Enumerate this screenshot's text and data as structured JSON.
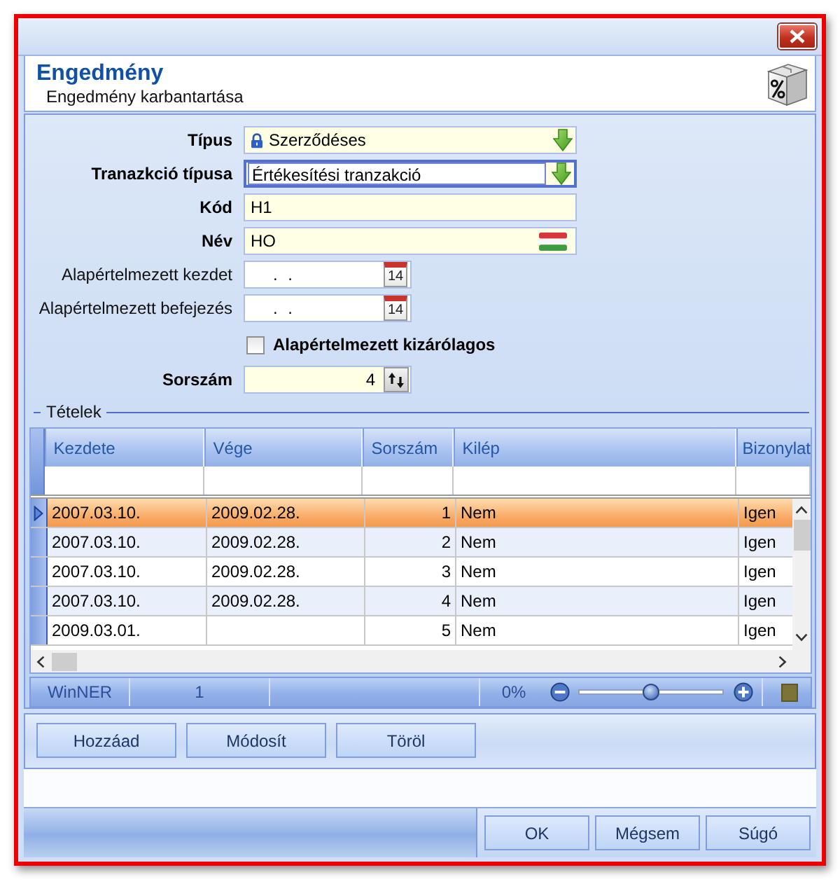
{
  "header": {
    "title": "Engedmény",
    "subtitle": "Engedmény karbantartása"
  },
  "form": {
    "fields": [
      {
        "kind": "dropdown",
        "label": "Típus",
        "value": "Szerződéses",
        "required": true,
        "locked": true,
        "focused": false
      },
      {
        "kind": "dropdown",
        "label": "Tranazkció típusa",
        "value": "Értékesítési tranzakció",
        "required": true,
        "locked": false,
        "focused": true
      },
      {
        "kind": "text",
        "label": "Kód",
        "value": "H1",
        "required": true,
        "locked": false,
        "focused": false
      },
      {
        "kind": "translatable",
        "label": "Név",
        "value": "HO",
        "required": true,
        "locked": false,
        "focused": false
      },
      {
        "kind": "date",
        "label": "Alapértelmezett kezdet",
        "value": ". .",
        "calendar_day": "14",
        "required": false,
        "locked": false,
        "focused": false
      },
      {
        "kind": "date",
        "label": "Alapértelmezett befejezés",
        "value": ". .",
        "calendar_day": "14",
        "required": false,
        "locked": false,
        "focused": false
      }
    ],
    "checkbox": {
      "label": "Alapértelmezett kizárólagos",
      "checked": false
    },
    "sequence": {
      "kind": "number",
      "label": "Sorszám",
      "value": "4",
      "required": true,
      "locked": false,
      "focused": false
    }
  },
  "items": {
    "title": "Tételek",
    "columns": [
      "Kezdete",
      "Vége",
      "Sorszám",
      "Kilép",
      "Bizonylat"
    ],
    "rows": [
      {
        "selected": true,
        "cells": [
          "2007.03.10.",
          "2009.02.28.",
          "1",
          "Nem",
          "Igen"
        ]
      },
      {
        "selected": false,
        "cells": [
          "2007.03.10.",
          "2009.02.28.",
          "2",
          "Nem",
          "Igen"
        ]
      },
      {
        "selected": false,
        "cells": [
          "2007.03.10.",
          "2009.02.28.",
          "3",
          "Nem",
          "Igen"
        ]
      },
      {
        "selected": false,
        "cells": [
          "2007.03.10.",
          "2009.02.28.",
          "4",
          "Nem",
          "Igen"
        ]
      },
      {
        "selected": false,
        "cells": [
          "2009.03.01.",
          null,
          "5",
          "Nem",
          "Igen"
        ]
      }
    ]
  },
  "status_bar": {
    "panels": [
      "WinNER",
      "1"
    ],
    "zoom": {
      "reading": "0%",
      "level": 0.5
    }
  },
  "actions": [
    "Hozzáad",
    "Módosít",
    "Töröl"
  ],
  "dialog_buttons": [
    "OK",
    "Mégsem",
    "Súgó"
  ]
}
